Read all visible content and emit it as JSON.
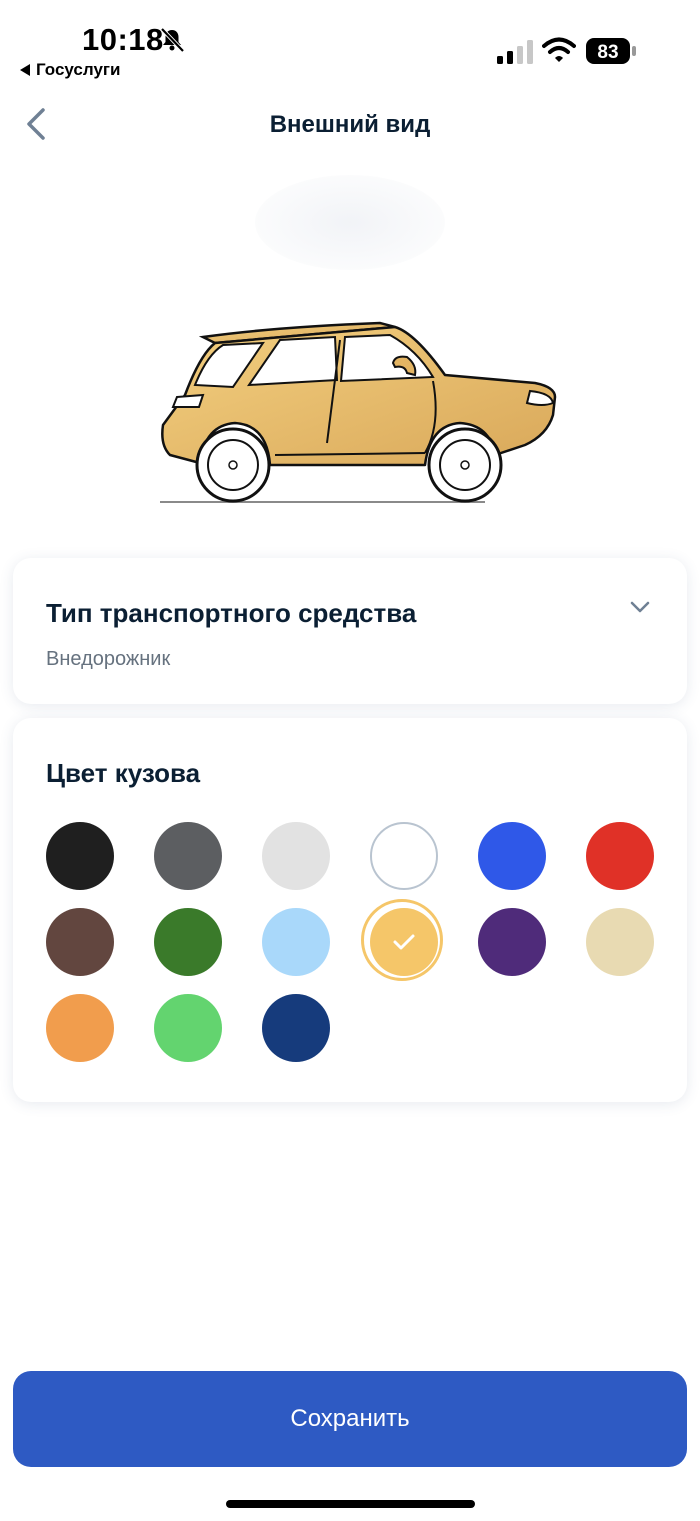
{
  "status_bar": {
    "time": "10:18",
    "back_app": "Госуслуги",
    "battery": "83"
  },
  "nav": {
    "title": "Внешний вид"
  },
  "vehicle_type": {
    "title": "Тип транспортного средства",
    "value": "Внедорожник"
  },
  "body_color": {
    "title": "Цвет кузова",
    "swatches": [
      {
        "color": "#1f1f1f"
      },
      {
        "color": "#5c5e61"
      },
      {
        "color": "#e2e2e2"
      },
      {
        "color": "#ffffff"
      },
      {
        "color": "#2f58e8"
      },
      {
        "color": "#e03127"
      },
      {
        "color": "#62463f"
      },
      {
        "color": "#3a7a2a"
      },
      {
        "color": "#a9d8fa"
      },
      {
        "color": "#f5c669",
        "selected": true
      },
      {
        "color": "#4f2b7a"
      },
      {
        "color": "#e8dab2"
      },
      {
        "color": "#f19d4d"
      },
      {
        "color": "#63d46f"
      },
      {
        "color": "#163b7c"
      }
    ]
  },
  "save_button": {
    "label": "Сохранить"
  },
  "colors": {
    "accent": "#2e5ac3",
    "car_body": "#e9bf6a"
  }
}
